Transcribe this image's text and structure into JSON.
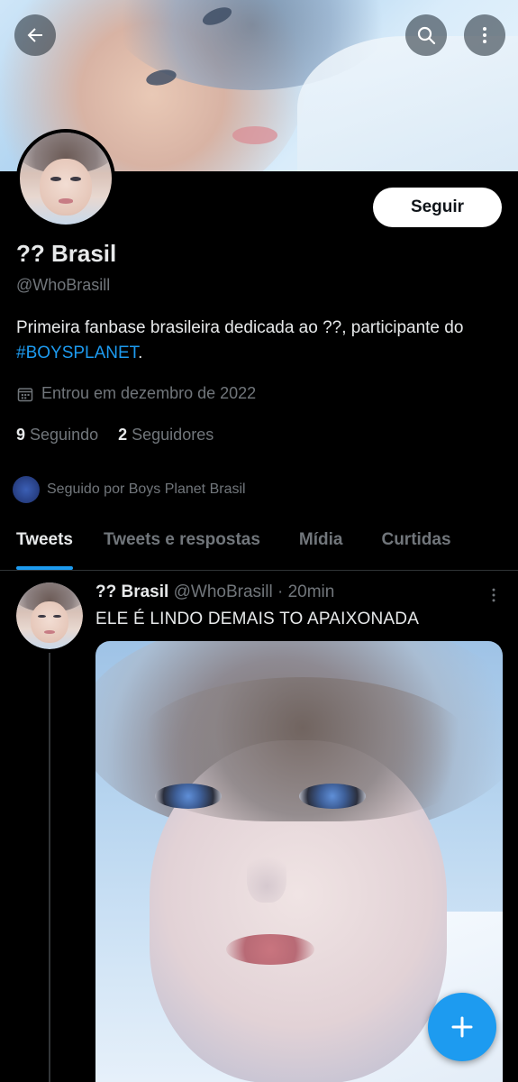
{
  "header": {
    "back_icon": "arrow-left-icon",
    "search_icon": "search-icon",
    "more_icon": "more-vertical-icon"
  },
  "profile": {
    "follow_label": "Seguir",
    "name": "?? Brasil",
    "handle": "@WhoBrasill",
    "bio_text": "Primeira fanbase brasileira dedicada ao ??, participante do ",
    "bio_hashtag": "#BOYSPLANET",
    "bio_end": ".",
    "joined": "Entrou em dezembro de 2022",
    "following_count": "9",
    "following_label": "Seguindo",
    "followers_count": "2",
    "followers_label": "Seguidores",
    "followed_by": "Seguido por Boys Planet Brasil"
  },
  "tabs": [
    {
      "label": "Tweets",
      "active": true
    },
    {
      "label": "Tweets e respostas",
      "active": false
    },
    {
      "label": "Mídia",
      "active": false
    },
    {
      "label": "Curtidas",
      "active": false
    }
  ],
  "tweet": {
    "author_name": "?? Brasil",
    "author_handle": "@WhoBrasill",
    "time": "20min",
    "text": "ELE É LINDO DEMAIS TO APAIXONADA"
  },
  "colors": {
    "accent": "#1d9bf0",
    "background": "#000000",
    "secondary_text": "#71767b"
  }
}
